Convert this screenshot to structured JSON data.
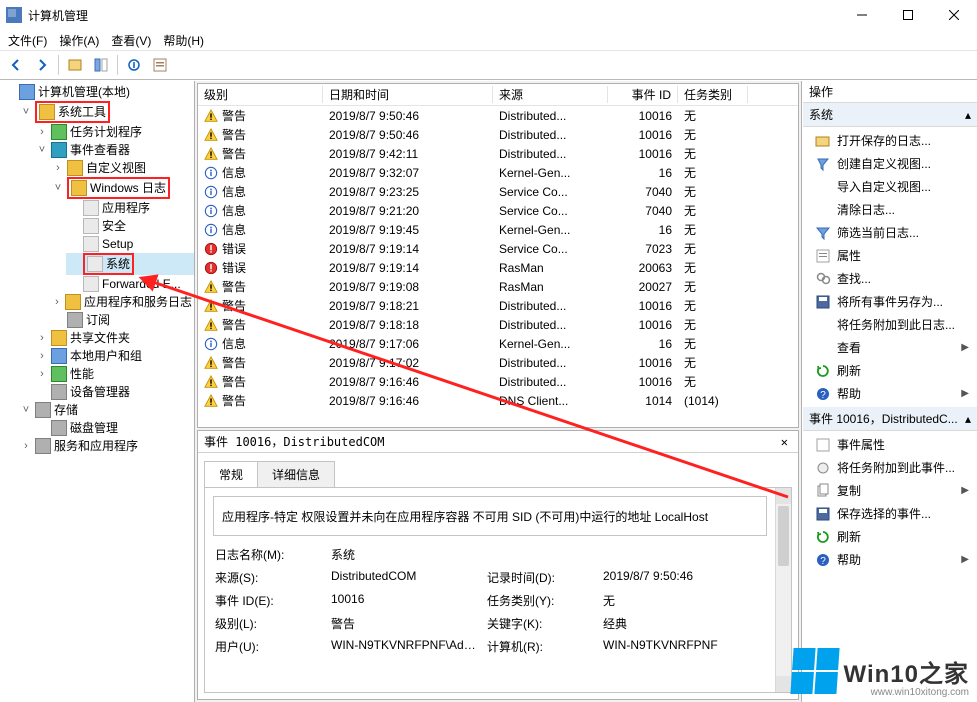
{
  "title": "计算机管理",
  "menu": {
    "file": "文件(F)",
    "op": "操作(A)",
    "view": "查看(V)",
    "help": "帮助(H)"
  },
  "tree": {
    "root": "计算机管理(本地)",
    "system_tools": "系统工具",
    "task_scheduler": "任务计划程序",
    "event_viewer": "事件查看器",
    "custom_views": "自定义视图",
    "windows_logs": "Windows 日志",
    "app_log": "应用程序",
    "security_log": "安全",
    "setup_log": "Setup",
    "system_log": "系统",
    "forwarded": "Forwarded E...",
    "app_svc_logs": "应用程序和服务日志",
    "subscriptions": "订阅",
    "shared_folders": "共享文件夹",
    "local_users": "本地用户和组",
    "performance": "性能",
    "device_mgr": "设备管理器",
    "storage": "存储",
    "disk_mgmt": "磁盘管理",
    "services_apps": "服务和应用程序"
  },
  "events": {
    "columns": {
      "level": "级别",
      "datetime": "日期和时间",
      "source": "来源",
      "event_id": "事件 ID",
      "category": "任务类别"
    },
    "rows": [
      {
        "level": "警告",
        "type": "warn",
        "datetime": "2019/8/7 9:50:46",
        "source": "Distributed...",
        "id": "10016",
        "cat": "无"
      },
      {
        "level": "警告",
        "type": "warn",
        "datetime": "2019/8/7 9:50:46",
        "source": "Distributed...",
        "id": "10016",
        "cat": "无"
      },
      {
        "level": "警告",
        "type": "warn",
        "datetime": "2019/8/7 9:42:11",
        "source": "Distributed...",
        "id": "10016",
        "cat": "无"
      },
      {
        "level": "信息",
        "type": "info",
        "datetime": "2019/8/7 9:32:07",
        "source": "Kernel-Gen...",
        "id": "16",
        "cat": "无"
      },
      {
        "level": "信息",
        "type": "info",
        "datetime": "2019/8/7 9:23:25",
        "source": "Service Co...",
        "id": "7040",
        "cat": "无"
      },
      {
        "level": "信息",
        "type": "info",
        "datetime": "2019/8/7 9:21:20",
        "source": "Service Co...",
        "id": "7040",
        "cat": "无"
      },
      {
        "level": "信息",
        "type": "info",
        "datetime": "2019/8/7 9:19:45",
        "source": "Kernel-Gen...",
        "id": "16",
        "cat": "无"
      },
      {
        "level": "错误",
        "type": "err",
        "datetime": "2019/8/7 9:19:14",
        "source": "Service Co...",
        "id": "7023",
        "cat": "无"
      },
      {
        "level": "错误",
        "type": "err",
        "datetime": "2019/8/7 9:19:14",
        "source": "RasMan",
        "id": "20063",
        "cat": "无"
      },
      {
        "level": "警告",
        "type": "warn",
        "datetime": "2019/8/7 9:19:08",
        "source": "RasMan",
        "id": "20027",
        "cat": "无"
      },
      {
        "level": "警告",
        "type": "warn",
        "datetime": "2019/8/7 9:18:21",
        "source": "Distributed...",
        "id": "10016",
        "cat": "无"
      },
      {
        "level": "警告",
        "type": "warn",
        "datetime": "2019/8/7 9:18:18",
        "source": "Distributed...",
        "id": "10016",
        "cat": "无"
      },
      {
        "level": "信息",
        "type": "info",
        "datetime": "2019/8/7 9:17:06",
        "source": "Kernel-Gen...",
        "id": "16",
        "cat": "无"
      },
      {
        "level": "警告",
        "type": "warn",
        "datetime": "2019/8/7 9:17:02",
        "source": "Distributed...",
        "id": "10016",
        "cat": "无"
      },
      {
        "level": "警告",
        "type": "warn",
        "datetime": "2019/8/7 9:16:46",
        "source": "Distributed...",
        "id": "10016",
        "cat": "无"
      },
      {
        "level": "警告",
        "type": "warn",
        "datetime": "2019/8/7 9:16:46",
        "source": "DNS Client...",
        "id": "1014",
        "cat": "(1014)"
      }
    ]
  },
  "detail": {
    "header": "事件 10016，DistributedCOM",
    "tab_general": "常规",
    "tab_details": "详细信息",
    "description": "应用程序-特定 权限设置并未向在应用程序容器 不可用 SID (不可用)中运行的地址 LocalHost",
    "fields": {
      "log_name_label": "日志名称(M):",
      "log_name": "系统",
      "source_label": "来源(S):",
      "source": "DistributedCOM",
      "logged_label": "记录时间(D):",
      "logged": "2019/8/7 9:50:46",
      "eventid_label": "事件 ID(E):",
      "eventid": "10016",
      "taskcat_label": "任务类别(Y):",
      "taskcat": "无",
      "level_label": "级别(L):",
      "level": "警告",
      "keywords_label": "关键字(K):",
      "keywords": "经典",
      "user_label": "用户(U):",
      "user": "WIN-N9TKVNRFPNF\\Adm...",
      "computer_label": "计算机(R):",
      "computer": "WIN-N9TKVNRFPNF"
    }
  },
  "actions": {
    "header": "操作",
    "group1": "系统",
    "g1": {
      "open_saved": "打开保存的日志...",
      "create_view": "创建自定义视图...",
      "import_view": "导入自定义视图...",
      "clear_log": "清除日志...",
      "filter": "筛选当前日志...",
      "properties": "属性",
      "find": "查找...",
      "save_all": "将所有事件另存为...",
      "attach_task": "将任务附加到此日志...",
      "view": "查看",
      "refresh": "刷新",
      "help": "帮助"
    },
    "group2": "事件 10016，DistributedC...",
    "g2": {
      "evt_props": "事件属性",
      "attach_evt": "将任务附加到此事件...",
      "copy": "复制",
      "save_sel": "保存选择的事件...",
      "refresh": "刷新",
      "help": "帮助"
    }
  },
  "watermark": {
    "text": "Win10之家",
    "url": "www.win10xitong.com"
  }
}
